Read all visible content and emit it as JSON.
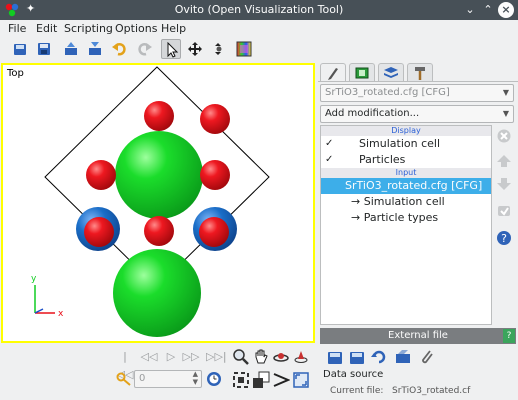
{
  "window": {
    "title": "Ovito (Open Visualization Tool)"
  },
  "menubar": {
    "items": [
      "File",
      "Edit",
      "Scripting",
      "Options",
      "Help"
    ]
  },
  "viewport": {
    "caption": "Top",
    "axis_x": "x",
    "axis_y": "y"
  },
  "panel": {
    "file_combo": "SrTiO3_rotated.cfg [CFG]",
    "modifier_combo": "Add modification...",
    "sections": {
      "display": "Display",
      "input": "Input"
    },
    "display_items": [
      {
        "label": "Simulation cell",
        "checked": true
      },
      {
        "label": "Particles",
        "checked": true
      }
    ],
    "input_item": "SrTiO3_rotated.cfg [CFG]",
    "sub_items": [
      "→ Simulation cell",
      "→ Particle types"
    ]
  },
  "external_file": {
    "header": "External file",
    "help": "?",
    "data_source_label": "Data source",
    "current_file_label": "Current file:",
    "current_file_value": "SrTiO3_rotated.cf"
  },
  "animation": {
    "frame": "0"
  },
  "colors": {
    "accent": "#3daee9",
    "titlebar": "#475057",
    "viewport_border": "#ffff00",
    "atom_red": "#e8101a",
    "atom_green": "#11cc22",
    "atom_blue": "#1a6ec8"
  }
}
